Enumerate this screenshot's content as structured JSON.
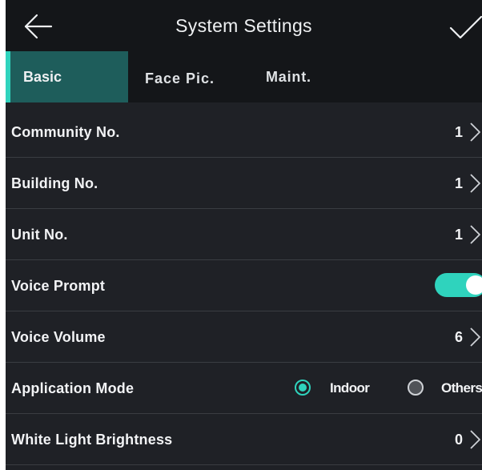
{
  "header": {
    "title": "System Settings",
    "back_icon": "arrow-left-icon",
    "confirm_icon": "checkmark-icon"
  },
  "tabs": [
    {
      "label": "Basic",
      "active": true
    },
    {
      "label": "Face Pic.",
      "active": false
    },
    {
      "label": "Maint.",
      "active": false
    }
  ],
  "settings": {
    "community_no": {
      "label": "Community No.",
      "value": "1"
    },
    "building_no": {
      "label": "Building No.",
      "value": "1"
    },
    "unit_no": {
      "label": "Unit No.",
      "value": "1"
    },
    "voice_prompt": {
      "label": "Voice Prompt",
      "enabled": true
    },
    "voice_volume": {
      "label": "Voice Volume",
      "value": "6"
    },
    "application_mode": {
      "label": "Application Mode",
      "options": [
        {
          "label": "Indoor",
          "selected": true
        },
        {
          "label": "Others",
          "selected": false
        }
      ]
    },
    "white_light_brightness": {
      "label": "White Light Brightness",
      "value": "0"
    }
  },
  "colors": {
    "accent": "#2fd3bd",
    "background": "#1f2126",
    "header": "#141619",
    "active_tab": "#1e5d5b"
  }
}
